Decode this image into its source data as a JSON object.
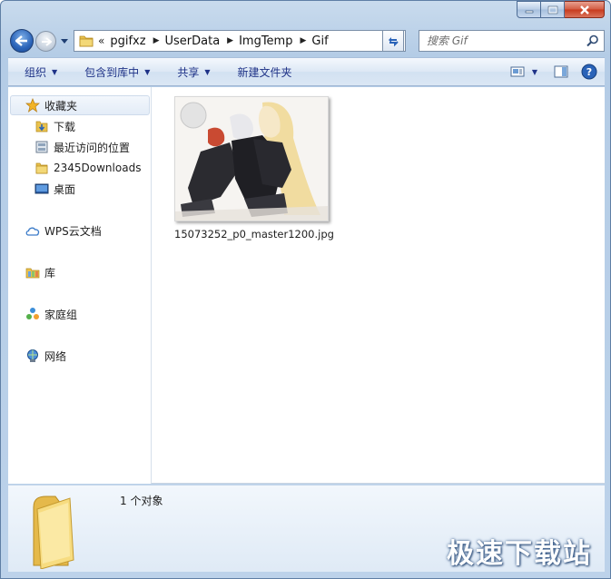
{
  "window": {
    "caption": {
      "minimize": "minimize",
      "maximize": "maximize",
      "close": "close"
    }
  },
  "address": {
    "overflow": "«",
    "crumbs": [
      "pgifxz",
      "UserData",
      "ImgTemp",
      "Gif"
    ]
  },
  "search": {
    "placeholder": "搜索 Gif"
  },
  "toolbar": {
    "organize": "组织",
    "include_in_library": "包含到库中",
    "share": "共享",
    "new_folder": "新建文件夹"
  },
  "navpane": {
    "favorites": "收藏夹",
    "downloads": "下载",
    "recent_places": "最近访问的位置",
    "downloads_2345": "2345Downloads",
    "desktop": "桌面",
    "wps_cloud": "WPS云文档",
    "libraries": "库",
    "homegroup": "家庭组",
    "network": "网络"
  },
  "files": [
    {
      "name": "15073252_p0_master1200.jpg"
    }
  ],
  "details": {
    "count": "1 个对象"
  },
  "watermark": "极速下载站",
  "colors": {
    "toolbar_text": "#1e3287",
    "frame": "#b4cce6"
  }
}
